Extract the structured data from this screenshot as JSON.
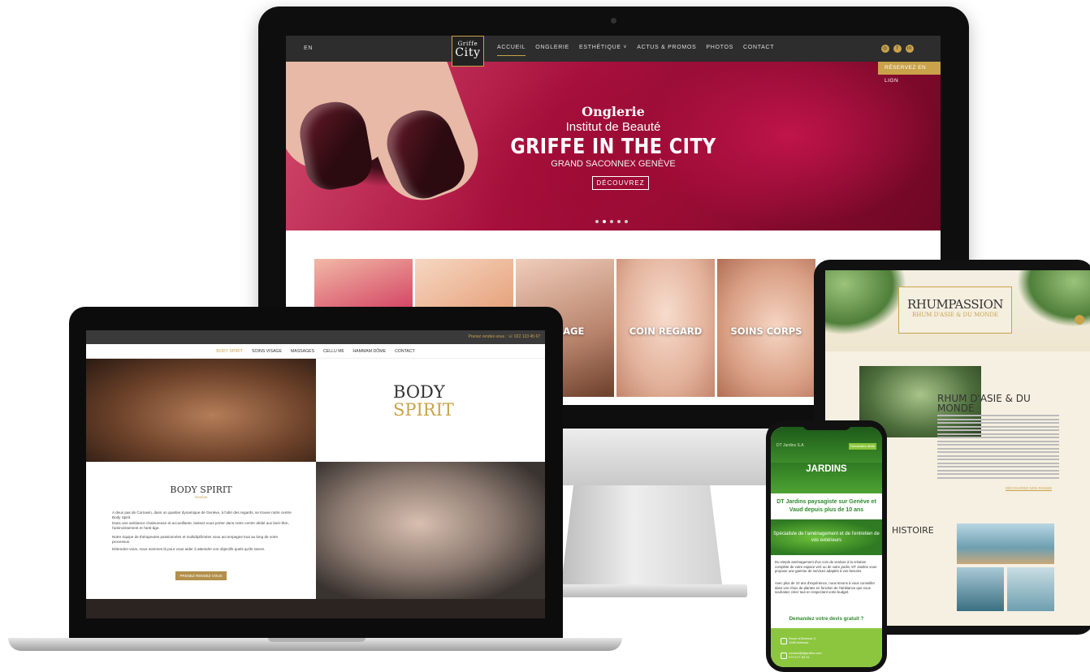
{
  "imac": {
    "nav": {
      "lang": "EN",
      "logo_line1": "Griffe",
      "logo_line2": "City",
      "links": [
        "ACCUEIL",
        "ONGLERIE",
        "ESTHÉTIQUE ˅",
        "ACTUS & PROMOS",
        "PHOTOS",
        "CONTACT"
      ],
      "social": [
        "◎",
        "f",
        "in"
      ],
      "reserve": "RÉSERVEZ EN LIGN"
    },
    "hero": {
      "line1": "Onglerie",
      "line2": "Institut de Beauté",
      "title": "GRIFFE IN THE CITY",
      "location": "GRAND SACONNEX GENÈVE",
      "button": "DÉCOUVREZ"
    },
    "tiles": [
      "",
      "",
      "VISAGE",
      "COIN REGARD",
      "SOINS CORPS"
    ]
  },
  "laptop": {
    "topbar": "Prenez rendez-vous : ☏ 022 123 45 67",
    "nav": [
      "BODY SPIRIT",
      "SOINS VISAGE",
      "MASSAGES",
      "CELLU M6",
      "HAMMAM DÔME",
      "CONTACT"
    ],
    "logo_line1": "BODY",
    "logo_line2": "SPIRIT",
    "title": "BODY SPIRIT",
    "subtitle": "Genève",
    "para1": "A deux pas de Cornavin, dans un quartier dynamique de Genève, à l'abri des regards, se trouve notre centre Body Spirit.",
    "para2": "Dans une ambiance chaleureuse et accueillante, laissez-vous porter dans notre centre dédié aux bien-être, l'amincissement et l'anti-âge.",
    "para3": "Notre équipe de thérapeutes passionnées et multidiplômées vous accompagne tout au long de votre processus.",
    "para4": "Détendez-vous, nous sommes là pour vous aider à atteindre vos objectifs quels qu'ils soient.",
    "button": "PRENEZ RENDEZ VOUS"
  },
  "tablet": {
    "brand": "RHUMPASSION",
    "brand_sub": "RHUM D'ASIE & DU MONDE",
    "heading": "RHUM D'ASIE & DU MONDE",
    "link": "DÉCOUVREZ NOS RHUMS",
    "history": "HISTOIRE"
  },
  "phone": {
    "brand": "DT Jardins S.A",
    "devis_btn": "Demandez devis",
    "hero": "JARDINS",
    "headline": "DT Jardins paysagiste sur Genève et Vaud depuis plus de 10 ans",
    "banner": "Spécialiste de l'aménagement et de l'entretien de vos extérieurs",
    "para1": "Du simple aménagement d'un coin de verdure à la création complète de votre espace vert ou de votre jardin, DT Jardins vous propose une gamme de services adaptés à vos besoins.",
    "para2": "Avec plus de 10 ans d'expérience, nous tenons à vous conseiller dans vos choix de plantes en fonction de l'ambiance que vous souhaitez créer tout en respectant votre budget.",
    "cta": "Demandez votre devis gratuit ?",
    "address": "Route d'Athenaz 3\n1285 Athenaz",
    "contact": "contact@dtjardins.com\n079 217 83 31"
  },
  "colors": {
    "gold": "#c9a24a",
    "green": "#2e8b2e",
    "lime": "#8cc63f"
  }
}
